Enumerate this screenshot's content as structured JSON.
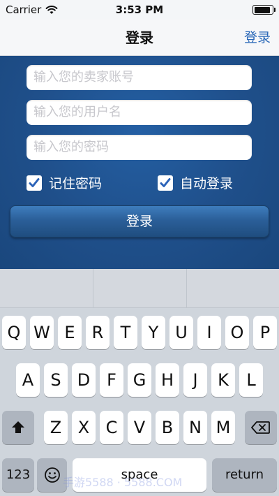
{
  "status": {
    "carrier": "Carrier",
    "time": "3:53 PM",
    "battery_level": 0.9
  },
  "nav": {
    "title": "登录",
    "right_button": "登录"
  },
  "form": {
    "seller_account": {
      "placeholder": "输入您的卖家账号",
      "value": ""
    },
    "username": {
      "placeholder": "输入您的用户名",
      "value": ""
    },
    "password": {
      "placeholder": "输入您的密码",
      "value": ""
    },
    "remember_password": {
      "label": "记住密码",
      "checked": true
    },
    "auto_login": {
      "label": "自动登录",
      "checked": true
    },
    "login_button": "登录"
  },
  "keyboard": {
    "row1": [
      "Q",
      "W",
      "E",
      "R",
      "T",
      "Y",
      "U",
      "I",
      "O",
      "P"
    ],
    "row2": [
      "A",
      "S",
      "D",
      "F",
      "G",
      "H",
      "J",
      "K",
      "L"
    ],
    "row3": [
      "Z",
      "X",
      "C",
      "V",
      "B",
      "N",
      "M"
    ],
    "numbers_key": "123",
    "space_key": "space",
    "return_key": "return",
    "emoji_icon": "emoji-icon",
    "shift_icon": "shift-icon",
    "delete_icon": "delete-icon"
  },
  "watermark": "手游5588 · 5588.COM"
}
